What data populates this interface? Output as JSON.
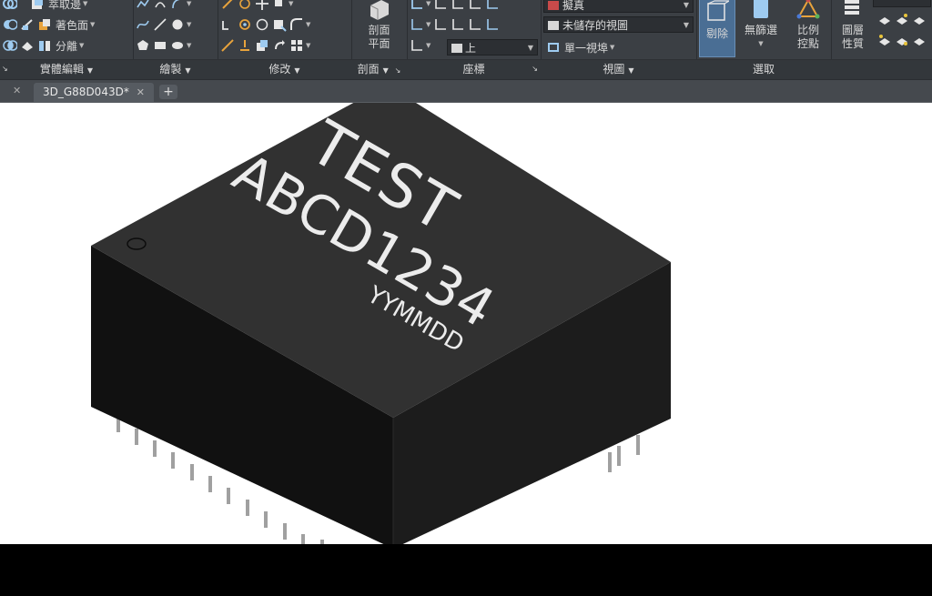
{
  "ribbon": {
    "panels": {
      "solid_editing": {
        "label": "實體編輯"
      },
      "draw": {
        "label": "繪製"
      },
      "modify": {
        "label": "修改"
      },
      "section": {
        "label": "剖面",
        "plane_button": "剖面\n平面"
      },
      "coordinates": {
        "label": "座標",
        "ucs_value": "上"
      },
      "view": {
        "label": "視圖",
        "visual_style": "擬真",
        "named_view": "未儲存的視圖",
        "viewport_config": "單一視埠"
      },
      "selection": {
        "label": "選取",
        "cull_button": "剔除",
        "no_filter_button": "無篩選",
        "gizmo_button": "比例\n控點"
      },
      "layers": {
        "properties_button": "圖層\n性質"
      }
    },
    "solid_editing_tools": {
      "extract_edges": "萃取邊",
      "color_faces": "著色面",
      "separate": "分離"
    }
  },
  "tabs": {
    "document_tab": "3D_G88D043D*"
  },
  "viewport": {
    "chip_text": {
      "line1": "TEST",
      "line2": "ABCD1234",
      "line3": "YYMMDD"
    }
  },
  "colors": {
    "ribbon_bg": "#3b3f44",
    "panel_footer_bg": "#33373b",
    "tab_strip_bg": "#45494e",
    "active_button": "#4a6e94",
    "chip_top": "#313131",
    "chip_left": "#111111",
    "chip_right": "#1c1c1c",
    "pins": "#a0a0a0"
  }
}
